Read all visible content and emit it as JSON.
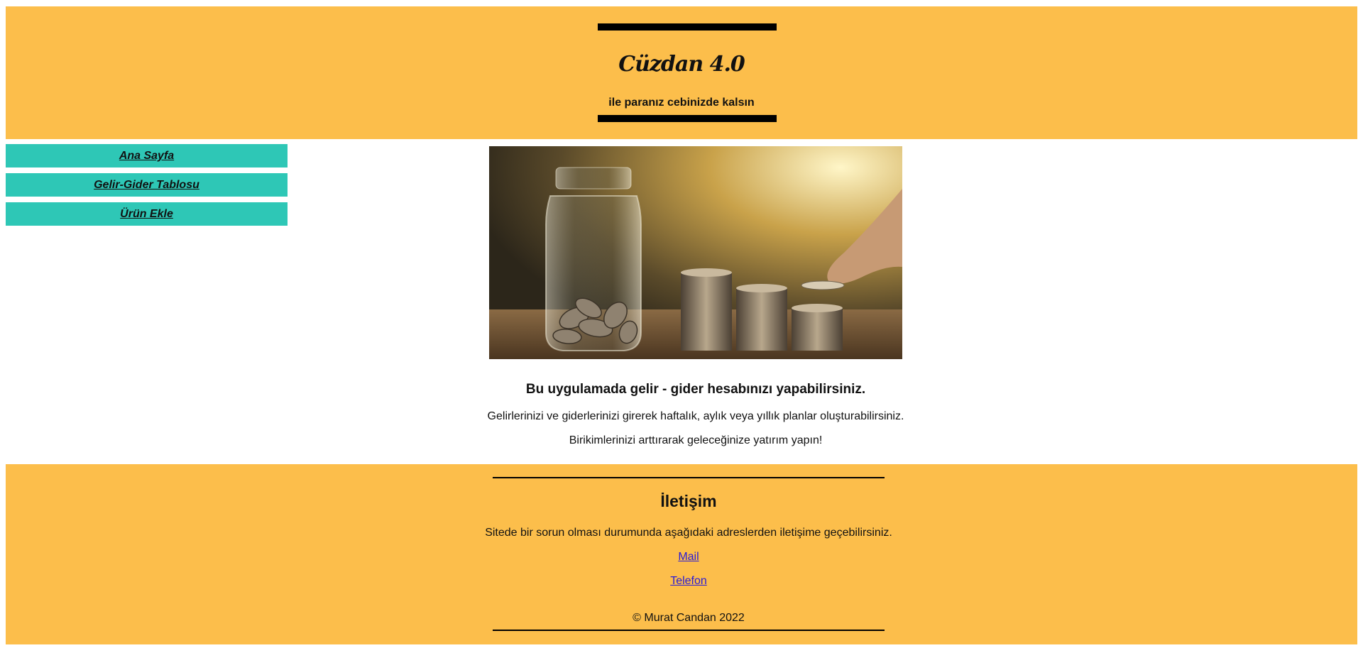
{
  "header": {
    "title": "Cüzdan 4.0",
    "tagline": "ile paranız cebinizde kalsın"
  },
  "sidebar": {
    "items": [
      {
        "label": "Ana Sayfa"
      },
      {
        "label": "Gelir-Gider Tablosu"
      },
      {
        "label": "Ürün Ekle"
      }
    ]
  },
  "main": {
    "headline": "Bu uygulamada gelir - gider hesabınızı yapabilirsiniz.",
    "paragraph1": "Gelirlerinizi ve giderlerinizi girerek haftalık, aylık veya yıllık planlar oluşturabilirsiniz.",
    "paragraph2": "Birikimlerinizi arttırarak geleceğinize yatırım yapın!"
  },
  "footer": {
    "title": "İletişim",
    "text": "Sitede bir sorun olması durumunda aşağıdaki adreslerden iletişime geçebilirsiniz.",
    "links": [
      {
        "label": "Mail"
      },
      {
        "label": "Telefon"
      }
    ],
    "copyright": "© Murat Candan 2022"
  },
  "colors": {
    "header_bg": "#fcbe4b",
    "nav_bg": "#2ec7b6",
    "link": "#2a1bd6"
  }
}
